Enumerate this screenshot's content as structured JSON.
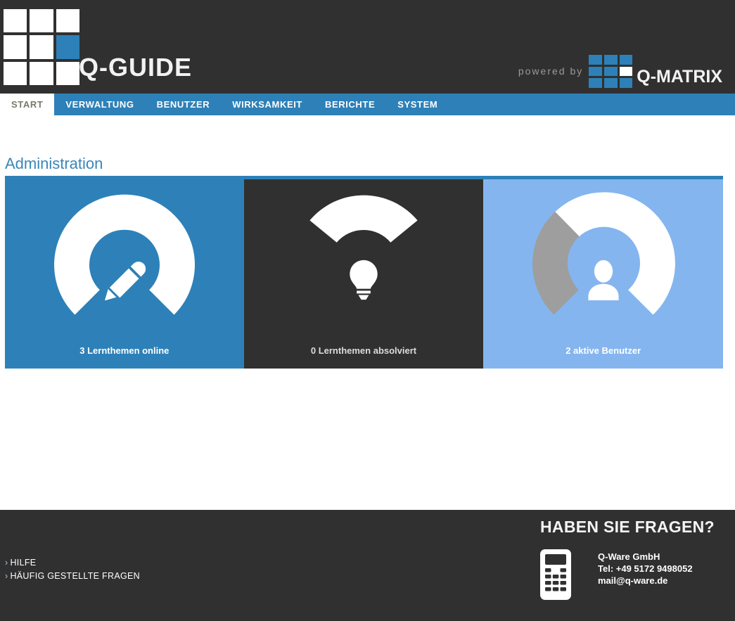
{
  "header": {
    "brand_title": "Q-GUIDE",
    "powered_by_label": "powered by",
    "partner_title": "Q-MATRIX",
    "logo_icon": "q-guide-grid-logo",
    "partner_logo_icon": "q-matrix-grid-logo",
    "background_color": "#303030",
    "accent_color": "#2d81b8"
  },
  "nav": {
    "items": [
      {
        "label": "START",
        "active": true
      },
      {
        "label": "VERWALTUNG",
        "active": false
      },
      {
        "label": "BENUTZER",
        "active": false
      },
      {
        "label": "WIRKSAMKEIT",
        "active": false
      },
      {
        "label": "BERICHTE",
        "active": false
      },
      {
        "label": "SYSTEM",
        "active": false
      }
    ],
    "background_color": "#2d81b8",
    "active_background_color": "#ffffff",
    "active_text_color": "#7a7a6e"
  },
  "main": {
    "page_title": "Administration",
    "title_color": "#3a87b8",
    "rule_color": "#2d81b8",
    "tiles": [
      {
        "label": "3 Lernthemen online",
        "icon": "pencil-icon",
        "background_color": "#2d81b8",
        "gauge_filled_color": "#ffffff",
        "gauge_track_color": "#2d81b8",
        "gauge_percent": 100
      },
      {
        "label": "0 Lernthemen absolviert",
        "icon": "lightbulb-icon",
        "background_color": "#303030",
        "gauge_filled_color": "#ffffff",
        "gauge_track_color": "#303030",
        "gauge_percent": 0
      },
      {
        "label": "2 aktive Benutzer",
        "icon": "person-icon",
        "background_color": "#85b5ef",
        "gauge_filled_color": "#ffffff",
        "gauge_track_color": "#9e9e9e",
        "gauge_percent": 75
      }
    ]
  },
  "footer": {
    "links": [
      {
        "chevron": "›",
        "label": "HILFE"
      },
      {
        "chevron": "›",
        "label": "HÄUFIG GESTELLTE FRAGEN"
      }
    ],
    "contact": {
      "heading": "HABEN SIE FRAGEN?",
      "icon": "mobile-phone-icon",
      "company": "Q-Ware GmbH",
      "phone": "Tel: +49 5172 9498052",
      "email": "mail@q-ware.de"
    },
    "background_color": "#303030"
  }
}
